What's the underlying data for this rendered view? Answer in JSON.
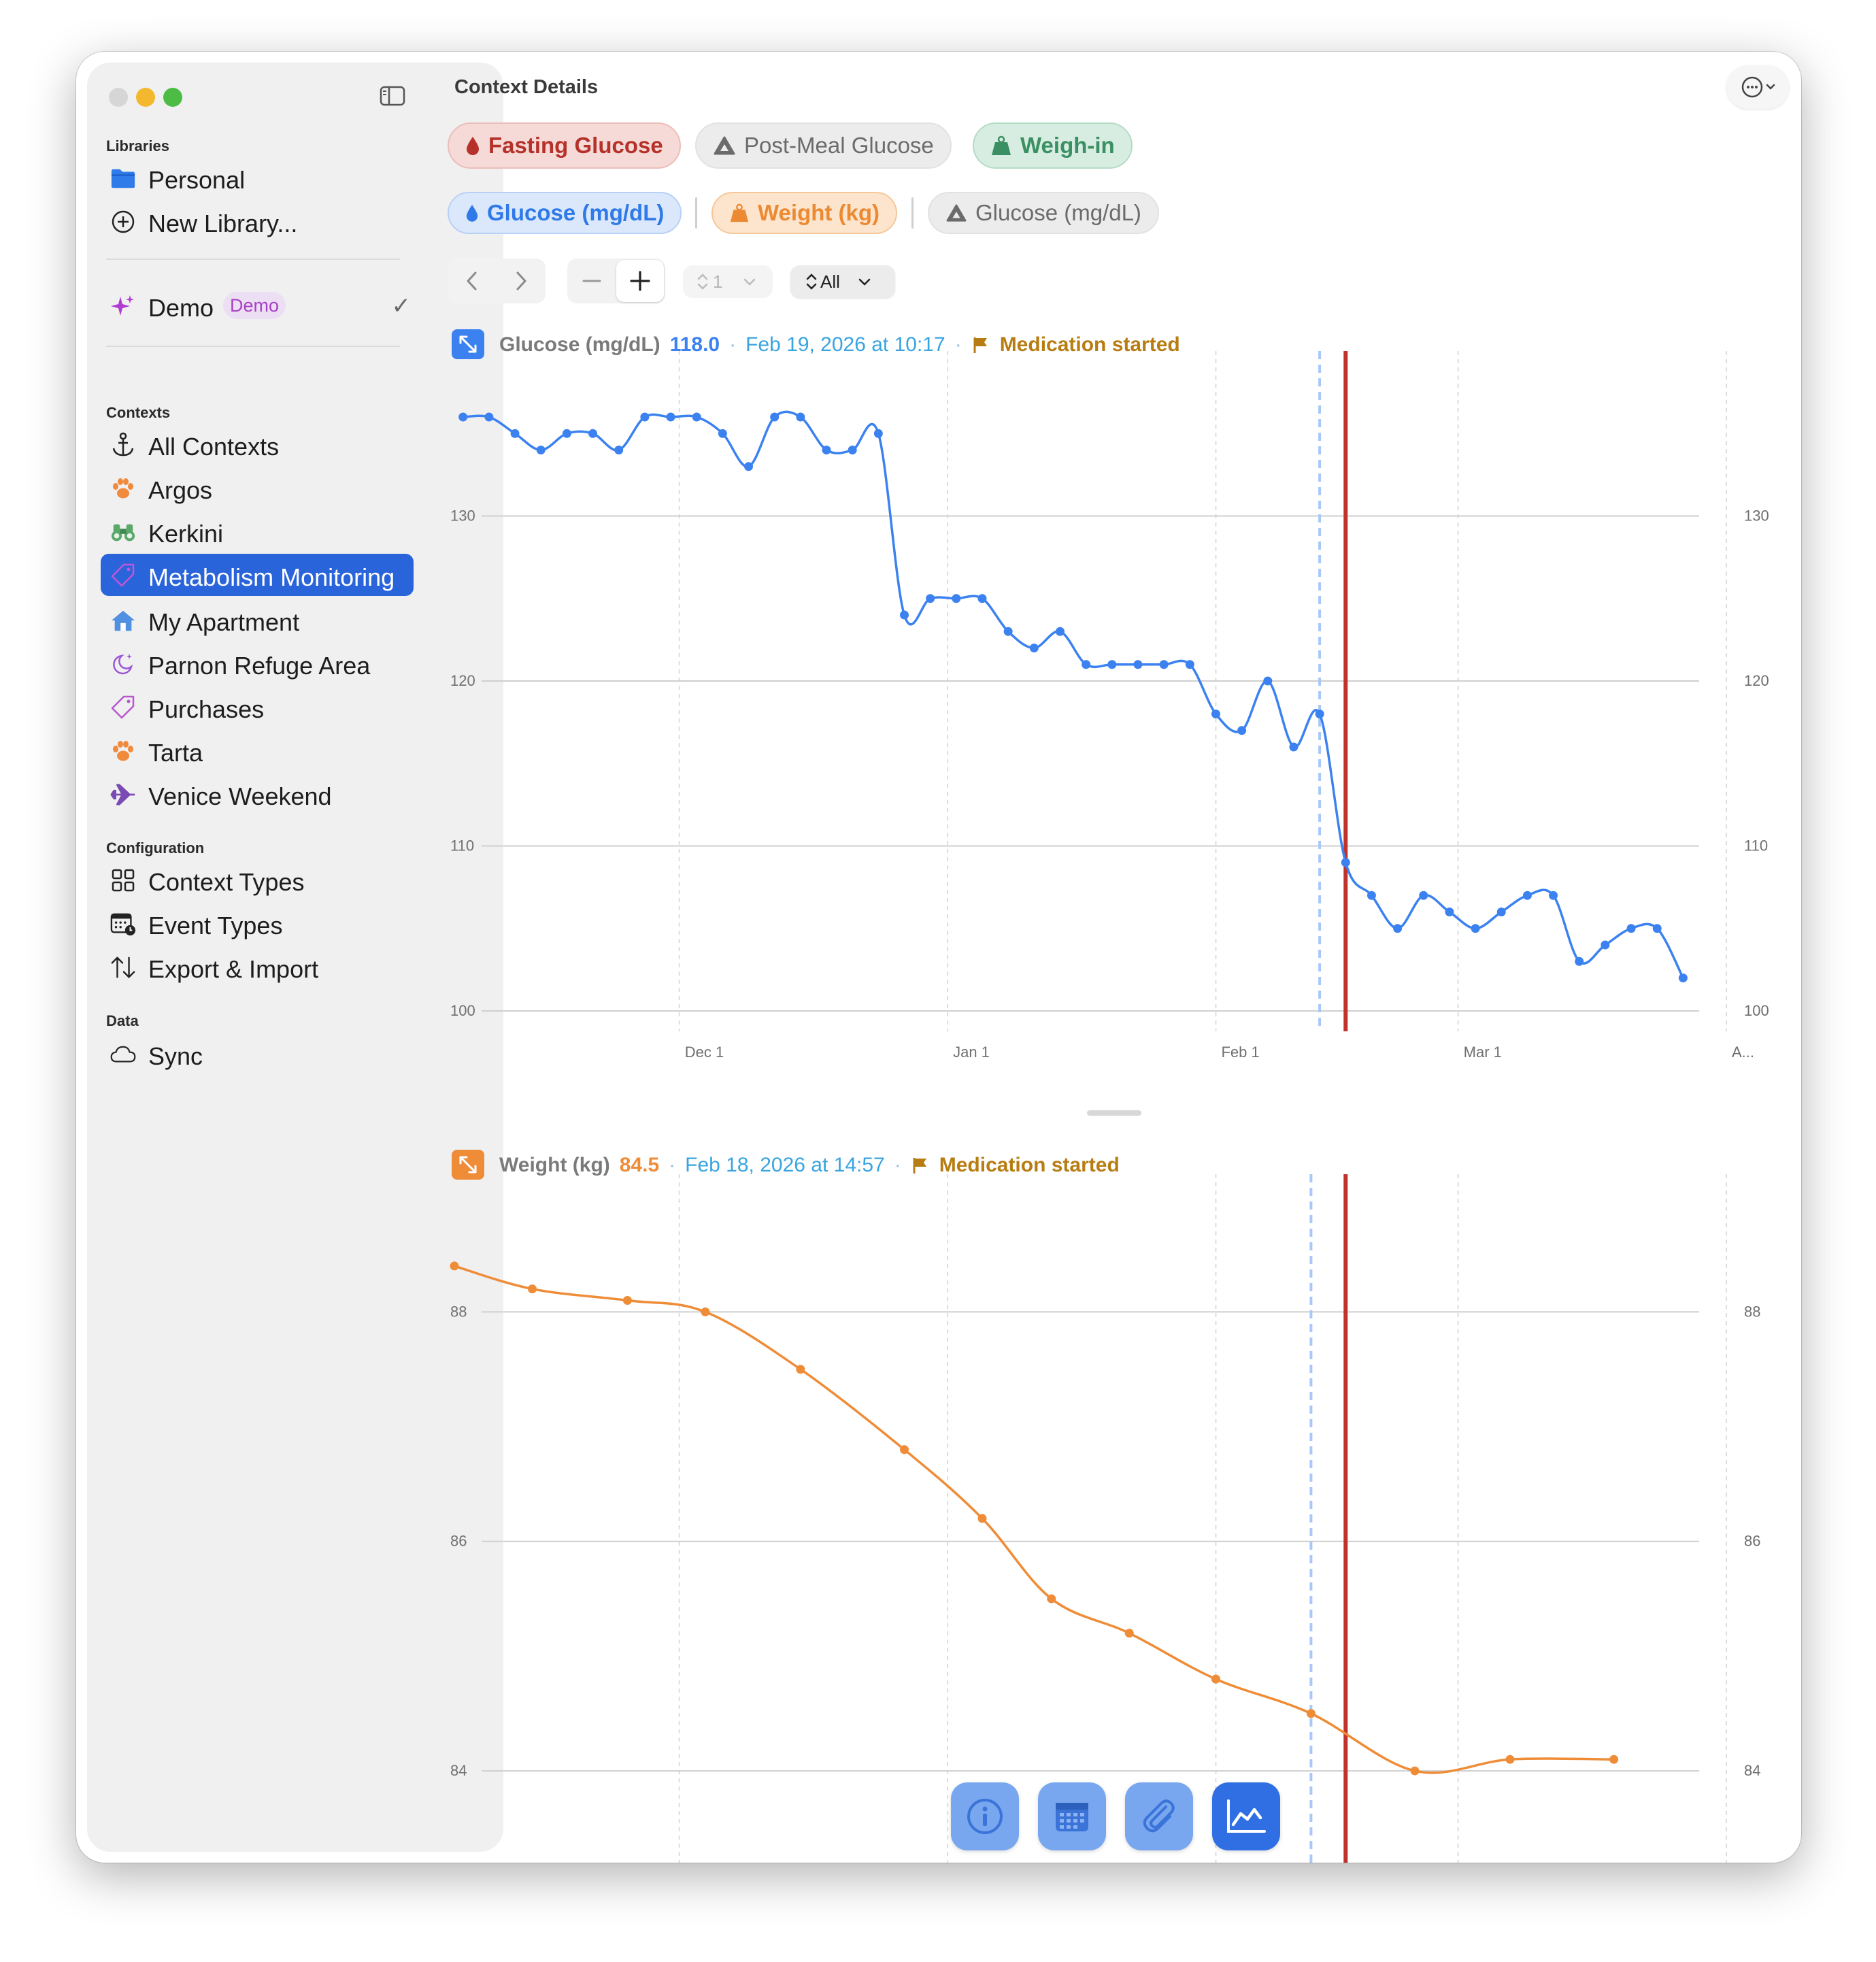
{
  "sidebar": {
    "libraries_title": "Libraries",
    "libraries": [
      {
        "label": "Personal",
        "icon": "folder-icon"
      },
      {
        "label": "New Library...",
        "icon": "plus-circle-icon"
      }
    ],
    "demo": {
      "label": "Demo",
      "badge": "Demo",
      "checked": true
    },
    "contexts_title": "Contexts",
    "contexts": [
      {
        "label": "All Contexts",
        "icon": "anchor-icon"
      },
      {
        "label": "Argos",
        "icon": "paw-icon"
      },
      {
        "label": "Kerkini",
        "icon": "binoculars-icon"
      },
      {
        "label": "Metabolism Monitoring",
        "icon": "tag-icon",
        "selected": true
      },
      {
        "label": "My Apartment",
        "icon": "house-icon"
      },
      {
        "label": "Parnon Refuge Area",
        "icon": "moon-stars-icon"
      },
      {
        "label": "Purchases",
        "icon": "tag-icon"
      },
      {
        "label": "Tarta",
        "icon": "paw-icon"
      },
      {
        "label": "Venice Weekend",
        "icon": "airplane-icon"
      }
    ],
    "configuration_title": "Configuration",
    "configuration": [
      {
        "label": "Context Types",
        "icon": "grid-icon"
      },
      {
        "label": "Event Types",
        "icon": "calendar-clock-icon"
      },
      {
        "label": "Export & Import",
        "icon": "arrows-up-down-icon"
      }
    ],
    "data_title": "Data",
    "data_items": [
      {
        "label": "Sync",
        "icon": "cloud-icon"
      }
    ]
  },
  "main": {
    "title": "Context Details",
    "event_chips": [
      {
        "label": "Fasting Glucose",
        "icon": "drop-icon",
        "style": "red"
      },
      {
        "label": "Post-Meal Glucose",
        "icon": "triangle-icon",
        "style": "gray"
      },
      {
        "label": "Weigh-in",
        "icon": "weight-icon",
        "style": "green"
      }
    ],
    "metric_chips": [
      {
        "label": "Glucose (mg/dL)",
        "icon": "drop-icon",
        "style": "blue"
      },
      {
        "label": "Weight (kg)",
        "icon": "weight-icon",
        "style": "orange"
      },
      {
        "label": "Glucose (mg/dL)",
        "icon": "triangle-icon",
        "style": "gray"
      }
    ],
    "toolbar": {
      "stepper_value": "1",
      "range_value": "All"
    }
  },
  "colors": {
    "glucose": "#3b82f0",
    "weight": "#ef8c37",
    "marker": "#c0322b",
    "selection": "#a9c8f7",
    "annotation": "#b77d12",
    "timestamp": "#39a4e0",
    "accent": "#2a64db"
  },
  "chart_glucose": {
    "metric": "Glucose (mg/dL)",
    "value": "118.0",
    "timestamp": "Feb 19, 2026 at 10:17",
    "annotation": "Medication started"
  },
  "chart_weight": {
    "metric": "Weight (kg)",
    "value": "84.5",
    "timestamp": "Feb 18, 2026 at 14:57",
    "annotation": "Medication started"
  },
  "chart_data": [
    {
      "type": "line",
      "title": "Glucose (mg/dL)",
      "xlabel": "",
      "ylabel": "",
      "x_ticks": [
        "Dec 1",
        "Jan 1",
        "Feb 1",
        "Mar 1",
        "A..."
      ],
      "ylim": [
        100,
        140
      ],
      "y_ticks": [
        100,
        110,
        120,
        130
      ],
      "grid": true,
      "series": [
        {
          "values": [
            [
              "2025-11-06",
              136
            ],
            [
              "2025-11-09",
              136
            ],
            [
              "2025-11-12",
              135
            ],
            [
              "2025-11-15",
              134
            ],
            [
              "2025-11-18",
              135
            ],
            [
              "2025-11-21",
              135
            ],
            [
              "2025-11-24",
              134
            ],
            [
              "2025-11-27",
              136
            ],
            [
              "2025-11-30",
              136
            ],
            [
              "2025-12-03",
              136
            ],
            [
              "2025-12-06",
              135
            ],
            [
              "2025-12-09",
              133
            ],
            [
              "2025-12-12",
              136
            ],
            [
              "2025-12-15",
              136
            ],
            [
              "2025-12-18",
              134
            ],
            [
              "2025-12-21",
              134
            ],
            [
              "2025-12-24",
              135
            ],
            [
              "2025-12-27",
              124
            ],
            [
              "2025-12-30",
              125
            ],
            [
              "2026-01-02",
              125
            ],
            [
              "2026-01-05",
              125
            ],
            [
              "2026-01-08",
              123
            ],
            [
              "2026-01-11",
              122
            ],
            [
              "2026-01-14",
              123
            ],
            [
              "2026-01-17",
              121
            ],
            [
              "2026-01-20",
              121
            ],
            [
              "2026-01-23",
              121
            ],
            [
              "2026-01-26",
              121
            ],
            [
              "2026-01-29",
              121
            ],
            [
              "2026-02-01",
              118
            ],
            [
              "2026-02-04",
              117
            ],
            [
              "2026-02-07",
              120
            ],
            [
              "2026-02-10",
              116
            ],
            [
              "2026-02-13",
              118
            ],
            [
              "2026-02-16",
              109
            ],
            [
              "2026-02-19",
              107
            ],
            [
              "2026-02-22",
              105
            ],
            [
              "2026-02-25",
              107
            ],
            [
              "2026-02-28",
              106
            ],
            [
              "2026-03-03",
              105
            ],
            [
              "2026-03-06",
              106
            ],
            [
              "2026-03-09",
              107
            ],
            [
              "2026-03-12",
              107
            ],
            [
              "2026-03-15",
              103
            ],
            [
              "2026-03-18",
              104
            ],
            [
              "2026-03-21",
              105
            ],
            [
              "2026-03-24",
              105
            ],
            [
              "2026-03-27",
              102
            ]
          ]
        }
      ],
      "selection_date": "2026-02-13",
      "marker_date": "2026-02-16",
      "marker_label": "Medication started"
    },
    {
      "type": "line",
      "title": "Weight (kg)",
      "xlabel": "",
      "ylabel": "",
      "ylim": [
        83.2,
        89.2
      ],
      "y_ticks": [
        84,
        86,
        88
      ],
      "grid": true,
      "series": [
        {
          "values": [
            [
              "2025-11-05",
              88.4
            ],
            [
              "2025-11-14",
              88.2
            ],
            [
              "2025-11-25",
              88.1
            ],
            [
              "2025-12-04",
              88.0
            ],
            [
              "2025-12-15",
              87.5
            ],
            [
              "2025-12-27",
              86.8
            ],
            [
              "2026-01-05",
              86.2
            ],
            [
              "2026-01-13",
              85.5
            ],
            [
              "2026-01-22",
              85.2
            ],
            [
              "2026-02-01",
              84.8
            ],
            [
              "2026-02-12",
              84.5
            ],
            [
              "2026-02-24",
              84.0
            ],
            [
              "2026-03-07",
              84.1
            ],
            [
              "2026-03-19",
              84.1
            ]
          ]
        }
      ],
      "selection_date": "2026-02-12",
      "marker_date": "2026-02-16",
      "marker_label": "Medication started"
    }
  ]
}
